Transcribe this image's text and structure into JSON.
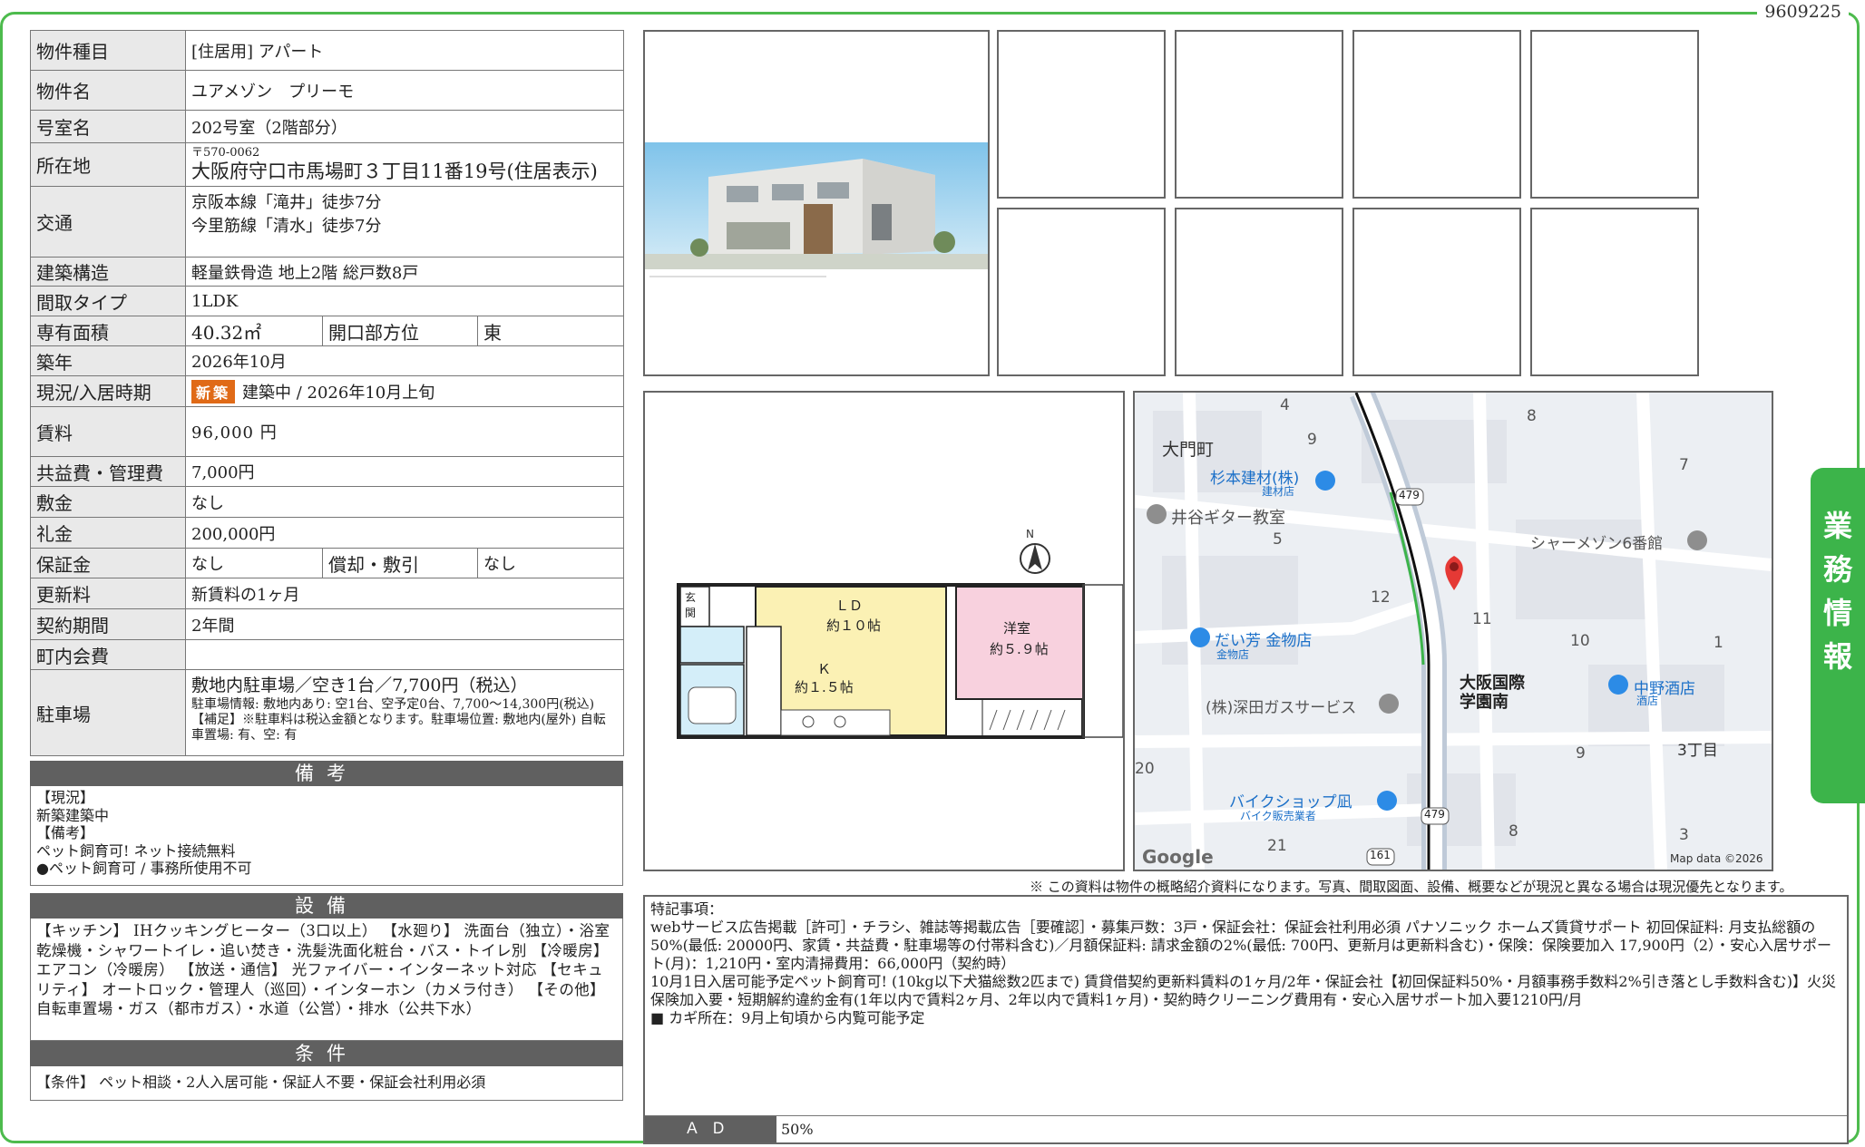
{
  "doc_id": "9609225",
  "spec": {
    "type_label": "物件種目",
    "type_value": "[住居用] アパート",
    "name_label": "物件名",
    "name_value": "ユアメゾン　プリーモ",
    "room_label": "号室名",
    "room_value": "202号室（2階部分）",
    "addr_label": "所在地",
    "addr_zip": "〒570-0062",
    "addr_value": "大阪府守口市馬場町３丁目11番19号(住居表示)",
    "transit_label": "交通",
    "transit_1": "京阪本線「滝井」徒歩7分",
    "transit_2": "今里筋線「清水」徒歩7分",
    "structure_label": "建築構造",
    "structure_value": "軽量鉄骨造 地上2階 総戸数8戸",
    "layout_label": "間取タイプ",
    "layout_value": "1LDK",
    "area_label": "専有面積",
    "area_value": "40.32㎡",
    "dir_label": "開口部方位",
    "dir_value": "東",
    "built_label": "築年",
    "built_value": "2026年10月",
    "status_label": "現況/入居時期",
    "status_badge": "新築",
    "status_value": "建築中 /  2026年10月上旬",
    "rent_label": "賃料",
    "rent_value": "96,000 円",
    "fee_label": "共益費・管理費",
    "fee_value": "7,000円",
    "deposit_label": "敷金",
    "deposit_value": "なし",
    "key_label": "礼金",
    "key_value": "200,000円",
    "guarantee_label": "保証金",
    "guarantee_value": "なし",
    "amort_label": "償却・敷引",
    "amort_value": "なし",
    "renewal_label": "更新料",
    "renewal_value": "新賃料の1ヶ月",
    "term_label": "契約期間",
    "term_value": "2年間",
    "town_label": "町内会費",
    "town_value": "",
    "parking_label": "駐車場",
    "parking_value": "敷地内駐車場／空き1台／7,700円（税込）",
    "parking_detail": "駐車場情報: 敷地内あり: 空1台、空予定0台、7,700〜14,300円(税込)【補足】※駐車料は税込金額となります。駐車場位置: 敷地内(屋外) 自転車置場: 有、空: 有"
  },
  "bikou": {
    "heading": "備考",
    "lines": [
      "【現況】",
      "新築建築中",
      "【備考】",
      "ペット飼育可! ネット接続無料",
      "●ペット飼育可 / 事務所使用不可"
    ]
  },
  "setsubi": {
    "heading": "設備",
    "text": "【キッチン】 IHクッキングヒーター（3口以上） 【水廻り】 洗面台（独立）・浴室乾燥機・シャワートイレ・追い焚き・洗髪洗面化粧台・バス・トイレ別 【冷暖房】 エアコン（冷暖房） 【放送・通信】 光ファイバー・インターネット対応 【セキュリティ】 オートロック・管理人（巡回）・インターホン（カメラ付き） 【その他】 自転車置場・ガス（都市ガス）・水道（公営）・排水（公共下水）"
  },
  "jouken": {
    "heading": "条件",
    "text": "【条件】 ペット相談・2人入居可能・保証人不要・保証会社利用必須"
  },
  "floorplan": {
    "entrance": "玄関",
    "ld": "ＬＤ",
    "ld_size": "約１０帖",
    "kitchen": "Ｋ",
    "kitchen_size": "約１.５帖",
    "western": "洋室",
    "western_size": "約５.９帖",
    "north": "N"
  },
  "map": {
    "labels": [
      "大門町",
      "杉本建材(株)",
      "建材店",
      "井谷ギター教室",
      "シャーメゾン6番館",
      "だい芳 金物店",
      "金物店",
      "大阪国際",
      "学園南",
      "(株)深田ガスサービス",
      "中野酒店",
      "酒店",
      "3丁目",
      "バイクショップ凪",
      "バイク販売業者"
    ],
    "numbers": [
      "4",
      "9",
      "8",
      "7",
      "5",
      "12",
      "11",
      "10",
      "1",
      "9",
      "20",
      "8",
      "21",
      "3"
    ],
    "roads": [
      "479",
      "479",
      "161"
    ],
    "logo": "Google",
    "credit": "Map data ©2026"
  },
  "disclaimer": "※ この資料は物件の概略紹介資料になります。写真、間取図面、設備、概要などが現況と異なる場合は現況優先となります。",
  "remarks": {
    "lines": [
      "特記事項：",
      "webサービス広告掲載［許可］・チラシ、雑誌等掲載広告［要確認］・募集戸数：3戸・保証会社：保証会社利用必須 パナソニック ホームズ賃貸サポート 初回保証料: 月支払総額の50%(最低: 20000円、家賃・共益費・駐車場等の付帯料含む)／月額保証料: 請求金額の2%(最低: 700円、更新月は更新料含む)・保険：保険要加入 17,900円（2）・安心入居サポート(月)：1,210円・室内清掃費用：66,000円（契約時）",
      "10月1日入居可能予定ペット飼育可! (10kg以下犬猫総数2匹まで) 賃貸借契約更新料賃料の1ヶ月/2年・保証会社【初回保証料50%・月額事務手数料2%引き落とし手数料含む)】火災保険加入要・短期解約違約金有(1年以内で賃料2ヶ月、2年以内で賃料1ヶ月)・契約時クリーニング費用有・安心入居サポート加入要1210円/月",
      "■ カギ所在：9月上旬頃から内覧可能予定"
    ],
    "ad_label": "ＡＤ",
    "ad_value": "50%"
  },
  "side_tab": [
    "業",
    "務",
    "情",
    "報"
  ],
  "colors": {
    "frame": "#4dbb4d",
    "tab": "#3cb44a",
    "badge": "#e06a17",
    "header_bar": "#606060",
    "ld_room": "#fbf1b4",
    "western_room": "#f8d1de",
    "map_pin": "#e53935"
  }
}
